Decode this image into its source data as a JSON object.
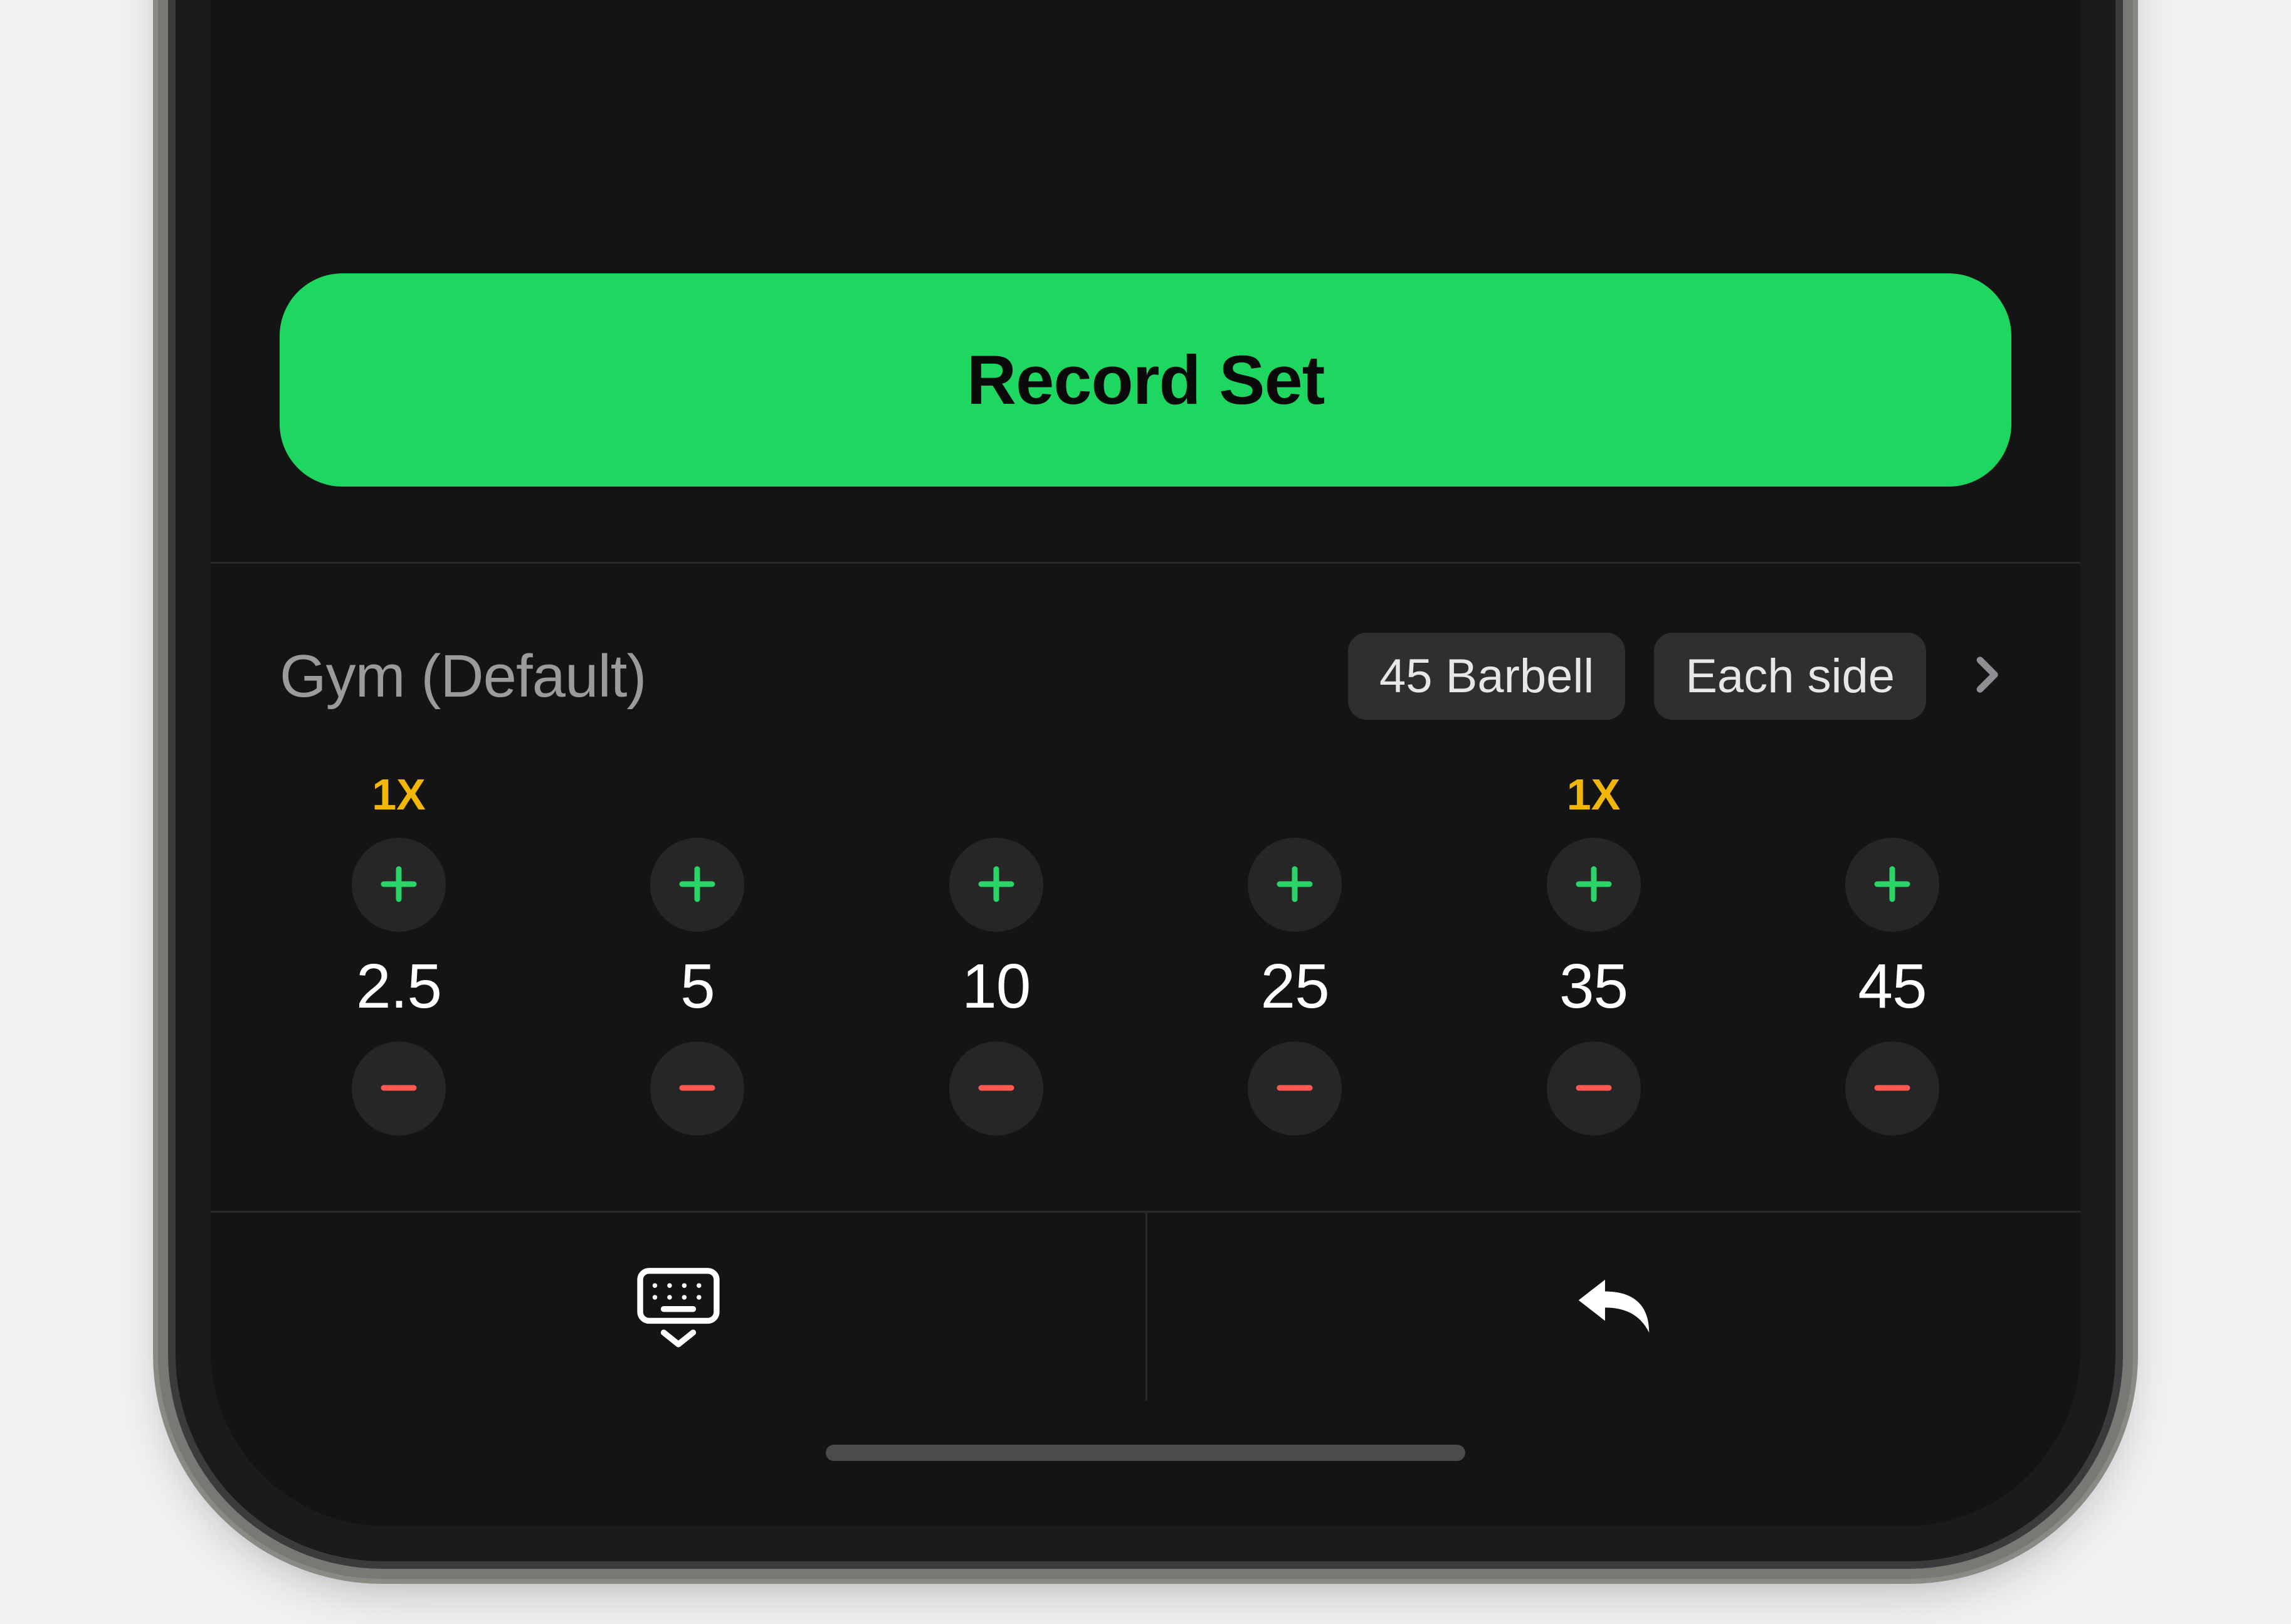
{
  "record_button_label": "Record Set",
  "gym": {
    "name": "Gym (Default)",
    "bar_chip": "45 Barbell",
    "side_chip": "Each side"
  },
  "plates": [
    {
      "weight": "2.5",
      "count": "1X"
    },
    {
      "weight": "5",
      "count": ""
    },
    {
      "weight": "10",
      "count": ""
    },
    {
      "weight": "25",
      "count": ""
    },
    {
      "weight": "35",
      "count": "1X"
    },
    {
      "weight": "45",
      "count": ""
    }
  ],
  "colors": {
    "accent_green": "#1ed760",
    "plus_green": "#2bd467",
    "minus_red": "#ff5a52",
    "count_yellow": "#f2b705"
  }
}
